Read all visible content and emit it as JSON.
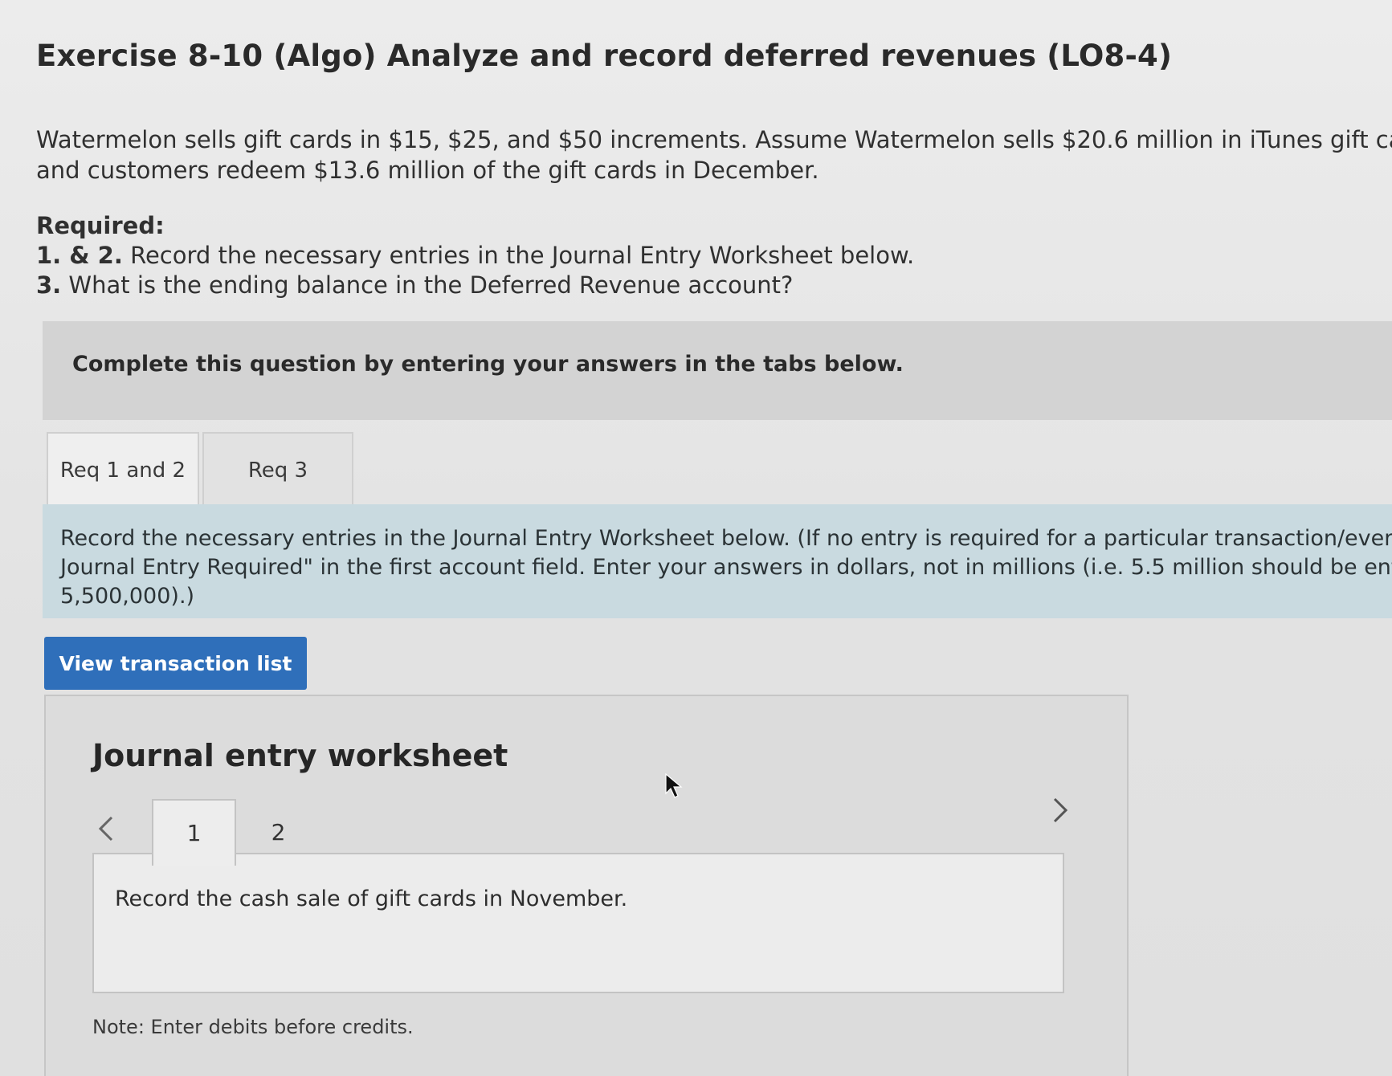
{
  "header": {
    "title": "Exercise 8-10 (Algo) Analyze and record deferred revenues (LO8-4)"
  },
  "intro": {
    "line1": "Watermelon sells gift cards in $15, $25, and $50 increments. Assume Watermelon sells $20.6 million in iTunes gift cards i",
    "line2": "and customers redeem $13.6 million of the gift cards in December."
  },
  "required": {
    "label": "Required:",
    "items": [
      {
        "num": "1. & 2.",
        "text": " Record the necessary entries in the Journal Entry Worksheet below."
      },
      {
        "num": "3.",
        "text": " What is the ending balance in the Deferred Revenue account?"
      }
    ]
  },
  "banner": {
    "text": "Complete this question by entering your answers in the tabs below."
  },
  "tabs": [
    {
      "label": "Req 1 and 2",
      "active": true
    },
    {
      "label": "Req 3",
      "active": false
    }
  ],
  "instruction": {
    "line1": "Record the necessary entries in the Journal Entry Worksheet below. (If no entry is required for a particular transaction/event,",
    "line2": "Journal Entry Required\" in the first account field. Enter your answers in dollars, not in millions (i.e. 5.5 million should be ente",
    "line3": "5,500,000).)"
  },
  "view_button": {
    "label": "View transaction list"
  },
  "worksheet": {
    "title": "Journal entry worksheet",
    "prev_icon": "chevron-left-icon",
    "next_icon": "chevron-right-icon",
    "tabs": [
      {
        "label": "1",
        "active": true
      },
      {
        "label": "2",
        "active": false
      }
    ],
    "panel_text": "Record the cash sale of gift cards in November.",
    "note": "Note: Enter debits before credits."
  },
  "colors": {
    "button": "#2f6fba",
    "instruction_bg": "#c9dae0",
    "banner_bg": "#d3d3d3"
  }
}
